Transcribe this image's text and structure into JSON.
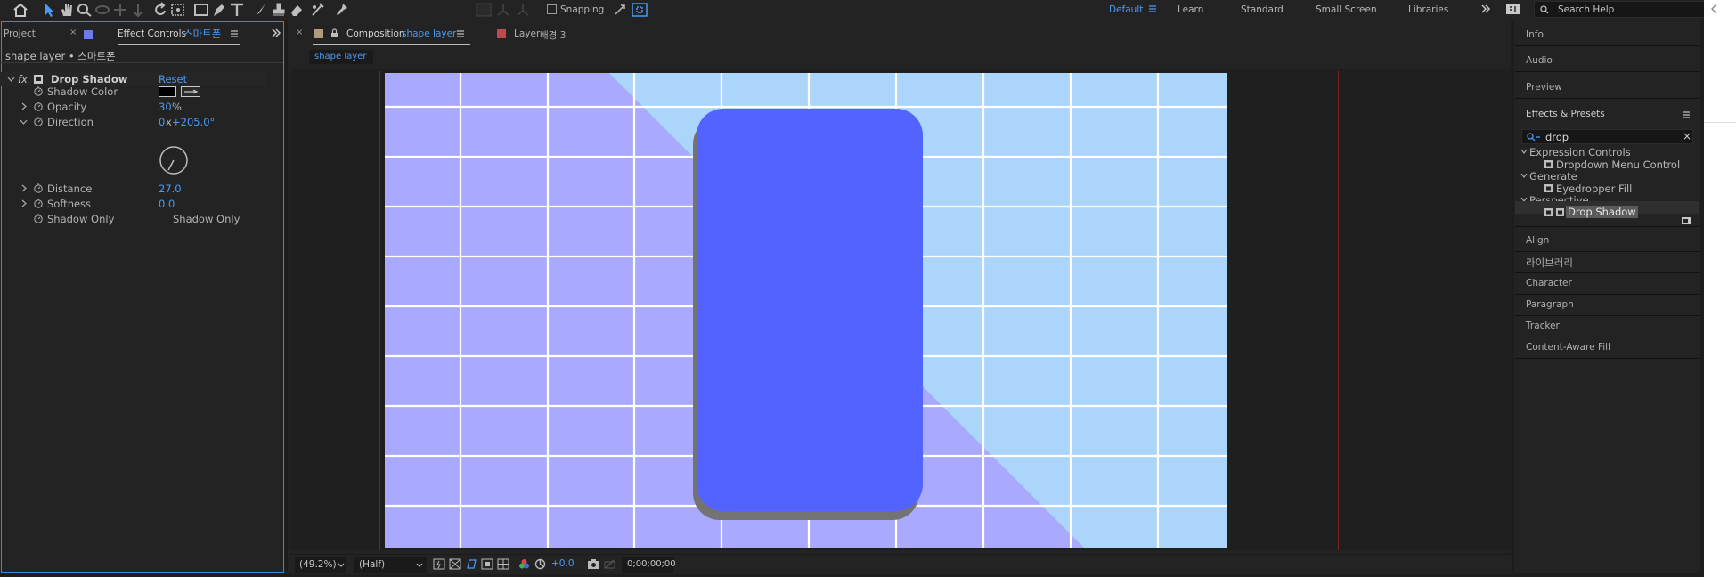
{
  "toolbar": {
    "snapping_label": "Snapping",
    "workspaces": [
      "Default",
      "Learn",
      "Standard",
      "Small Screen",
      "Libraries"
    ],
    "active_workspace": "Default",
    "search_placeholder": "Search Help"
  },
  "left_panel": {
    "tabs": [
      "Project",
      "Effect Controls",
      "스마트폰"
    ],
    "layer_path": "shape layer • 스마트폰",
    "effect": {
      "icon": "fx",
      "name": "Drop Shadow",
      "reset_label": "Reset",
      "properties": [
        {
          "name": "Shadow Color",
          "value": "",
          "swatch": "#000000"
        },
        {
          "name": "Opacity",
          "value": "30",
          "unit": "%"
        },
        {
          "name": "Direction",
          "value_prefix": "0",
          "value_mid": "x",
          "value": "+205.0°"
        },
        {
          "name": "Distance",
          "value": "27.0"
        },
        {
          "name": "Softness",
          "value": "0.0"
        },
        {
          "name": "Shadow Only",
          "checkbox_label": "Shadow Only",
          "checked": false
        }
      ]
    }
  },
  "comp_panel": {
    "tab_label": "Composition",
    "tab_name": "shape layer",
    "layer_tab_label": "Layer",
    "layer_tab_name": "배경 3",
    "flowchart_tab": "shape layer",
    "canvas": {
      "bg_light": "#acd5fc",
      "bg_purple": "#a9aafd",
      "phone_color": "#5263ff",
      "shadow_color": "#737373"
    },
    "footer": {
      "zoom": "(49.2%)",
      "resolution": "(Half)",
      "exposure": "+0.0",
      "timecode": "0;00;00;00"
    }
  },
  "right_panel": {
    "top_items": [
      "Info",
      "Audio",
      "Preview"
    ],
    "effects_presets": {
      "title": "Effects & Presets",
      "search_value": "drop",
      "groups": [
        {
          "name": "Expression Controls",
          "items": [
            "Dropdown Menu Control"
          ]
        },
        {
          "name": "Generate",
          "items": [
            "Eyedropper Fill"
          ]
        },
        {
          "name": "Perspective",
          "items": [
            "Drop Shadow"
          ]
        }
      ]
    },
    "bottom_items": [
      "Align",
      "라이브러리",
      "Character",
      "Paragraph",
      "Tracker",
      "Content-Aware Fill"
    ]
  }
}
